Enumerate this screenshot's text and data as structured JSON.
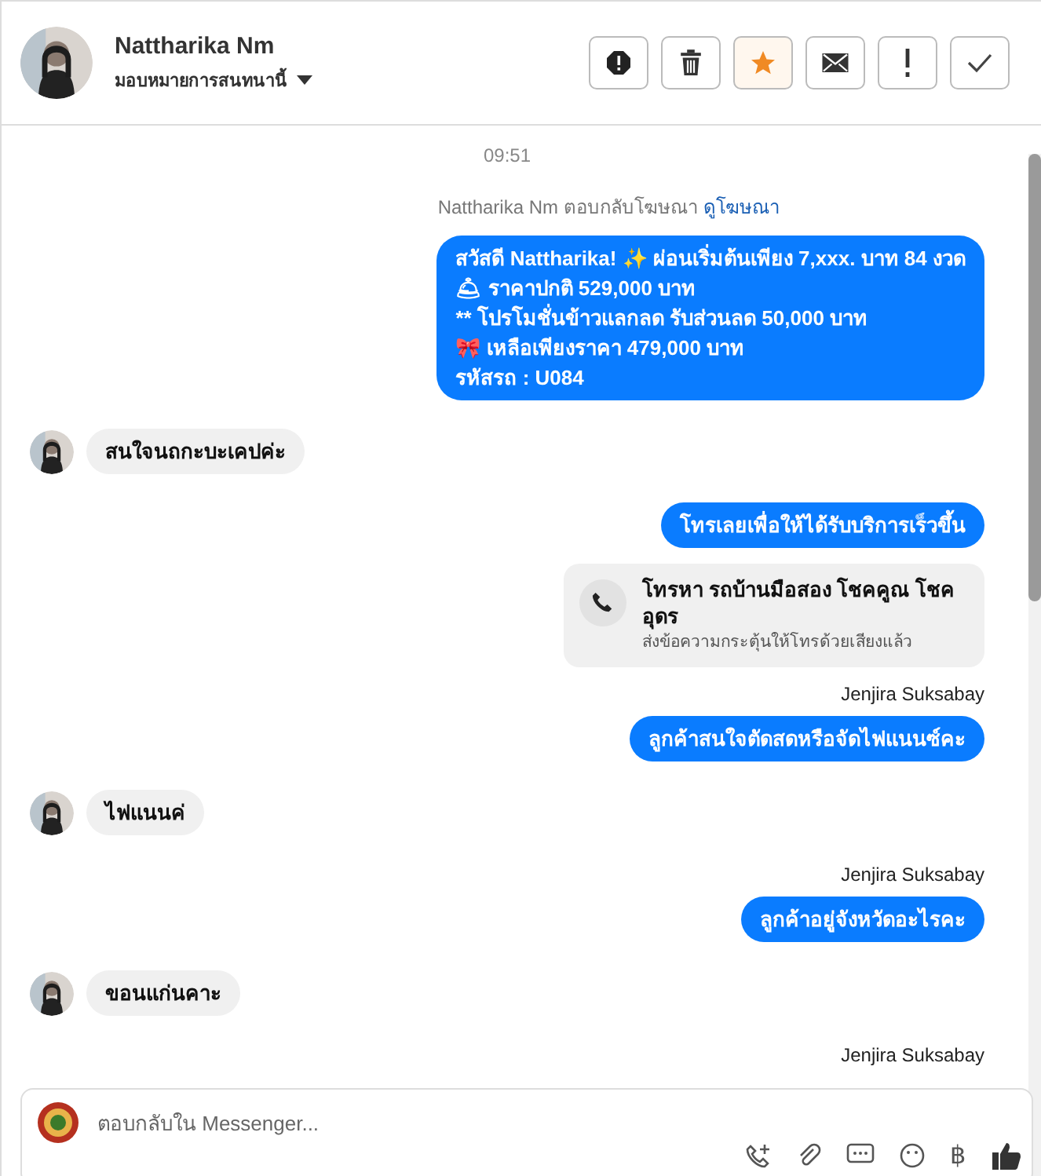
{
  "header": {
    "name": "Nattharika Nm",
    "assign_label": "มอบหมายการสนทนานี้",
    "actions": [
      {
        "kind": "block",
        "active": false
      },
      {
        "kind": "trash",
        "active": false
      },
      {
        "kind": "star",
        "active": true
      },
      {
        "kind": "mail",
        "active": false
      },
      {
        "kind": "exclaim",
        "active": false
      },
      {
        "kind": "check",
        "active": false
      }
    ]
  },
  "chat": {
    "timestamp": "09:51",
    "ad_notice": {
      "text": "Nattharika Nm ตอบกลับโฆษณา",
      "link": "ดูโฆษณา"
    },
    "messages": [
      {
        "kind": "outgoing",
        "lines": [
          "สวัสดี Nattharika! ✨  ผ่อนเริ่มต้นเพียง 7,xxx. บาท 84 งวด",
          "🛎 ราคาปกติ 529,000 บาท",
          "** โปรโมชั่นข้าวแลกลด รับส่วนลด 50,000 บาท",
          "🎀  เหลือเพียงราคา 479,000 บาท",
          " รหัสรถ : U084"
        ]
      },
      {
        "kind": "incoming",
        "text": "สนใจนถกะบะเคปค่ะ"
      },
      {
        "kind": "outgoing",
        "lines": [
          "โทรเลยเพื่อให้ได้รับบริการเร็วขึ้น"
        ]
      },
      {
        "kind": "call_card",
        "title": "โทรหา รถบ้านมือสอง โชคคูณ โชคอุดร",
        "subtitle": "ส่งข้อความกระตุ้นให้โทรด้วยเสียงแล้ว"
      },
      {
        "kind": "sender",
        "text": "Jenjira Suksabay"
      },
      {
        "kind": "outgoing",
        "lines": [
          "ลูกค้าสนใจตัดสดหรือจัดไฟแนนซ์คะ"
        ]
      },
      {
        "kind": "incoming",
        "text": "ไฟแนนค่"
      },
      {
        "kind": "sender",
        "text": "Jenjira Suksabay"
      },
      {
        "kind": "outgoing",
        "lines": [
          "ลูกค้าอยู่จังหวัดอะไรคะ"
        ]
      },
      {
        "kind": "incoming",
        "text": "ขอนแก่นคาะ"
      },
      {
        "kind": "sender",
        "text": "Jenjira Suksabay"
      }
    ]
  },
  "composer": {
    "placeholder": "ตอบกลับใน Messenger...",
    "currency_symbol": "฿"
  }
}
